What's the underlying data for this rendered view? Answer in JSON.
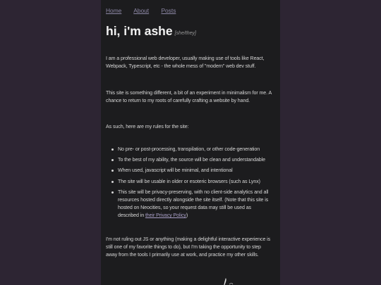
{
  "nav": {
    "home": "Home",
    "about": "About",
    "posts": "Posts"
  },
  "header": {
    "title": "hi, i'm ashe",
    "pronouns": "[she/they]"
  },
  "content": {
    "intro": "I am a professional web developer, usually making use of tools like React, Webpack, Typescript, etc - the whole mess of \"modern\" web dev stuff.",
    "different": "This site is something different, a bit of an experiment in minimalism for me. A chance to return to my roots of carefully crafting a website by hand.",
    "rules_intro": "As such, here are my rules for the site:",
    "rules": [
      "No pre- or post-processing, transpilation, or other code-generation",
      "To the best of my ability, the source will be clean and understandable",
      "When used, javascript will be minimal, and intentional",
      "The site will be usable in older or esoteric browsers (such as Lynx)"
    ],
    "privacy_rule": "This site will be privacy-preserving, with no client-side analytics and all resources hosted directly alongside the site itself. (Note that this site is hosted on Neocities, so your request data may still be used as described in",
    "privacy_link": "their Privacy Policy",
    "privacy_close": ")",
    "closing": "I'm not ruling out JS or anything (making a delightful interactive experience is still one of my favorite things to do), but I'm taking the opportunity to step away from the tools I primarily use at work, and practice my other skills."
  },
  "colors": {
    "background": "#2d2533",
    "page": "#1c1c1e",
    "link": "#8d88a6"
  }
}
